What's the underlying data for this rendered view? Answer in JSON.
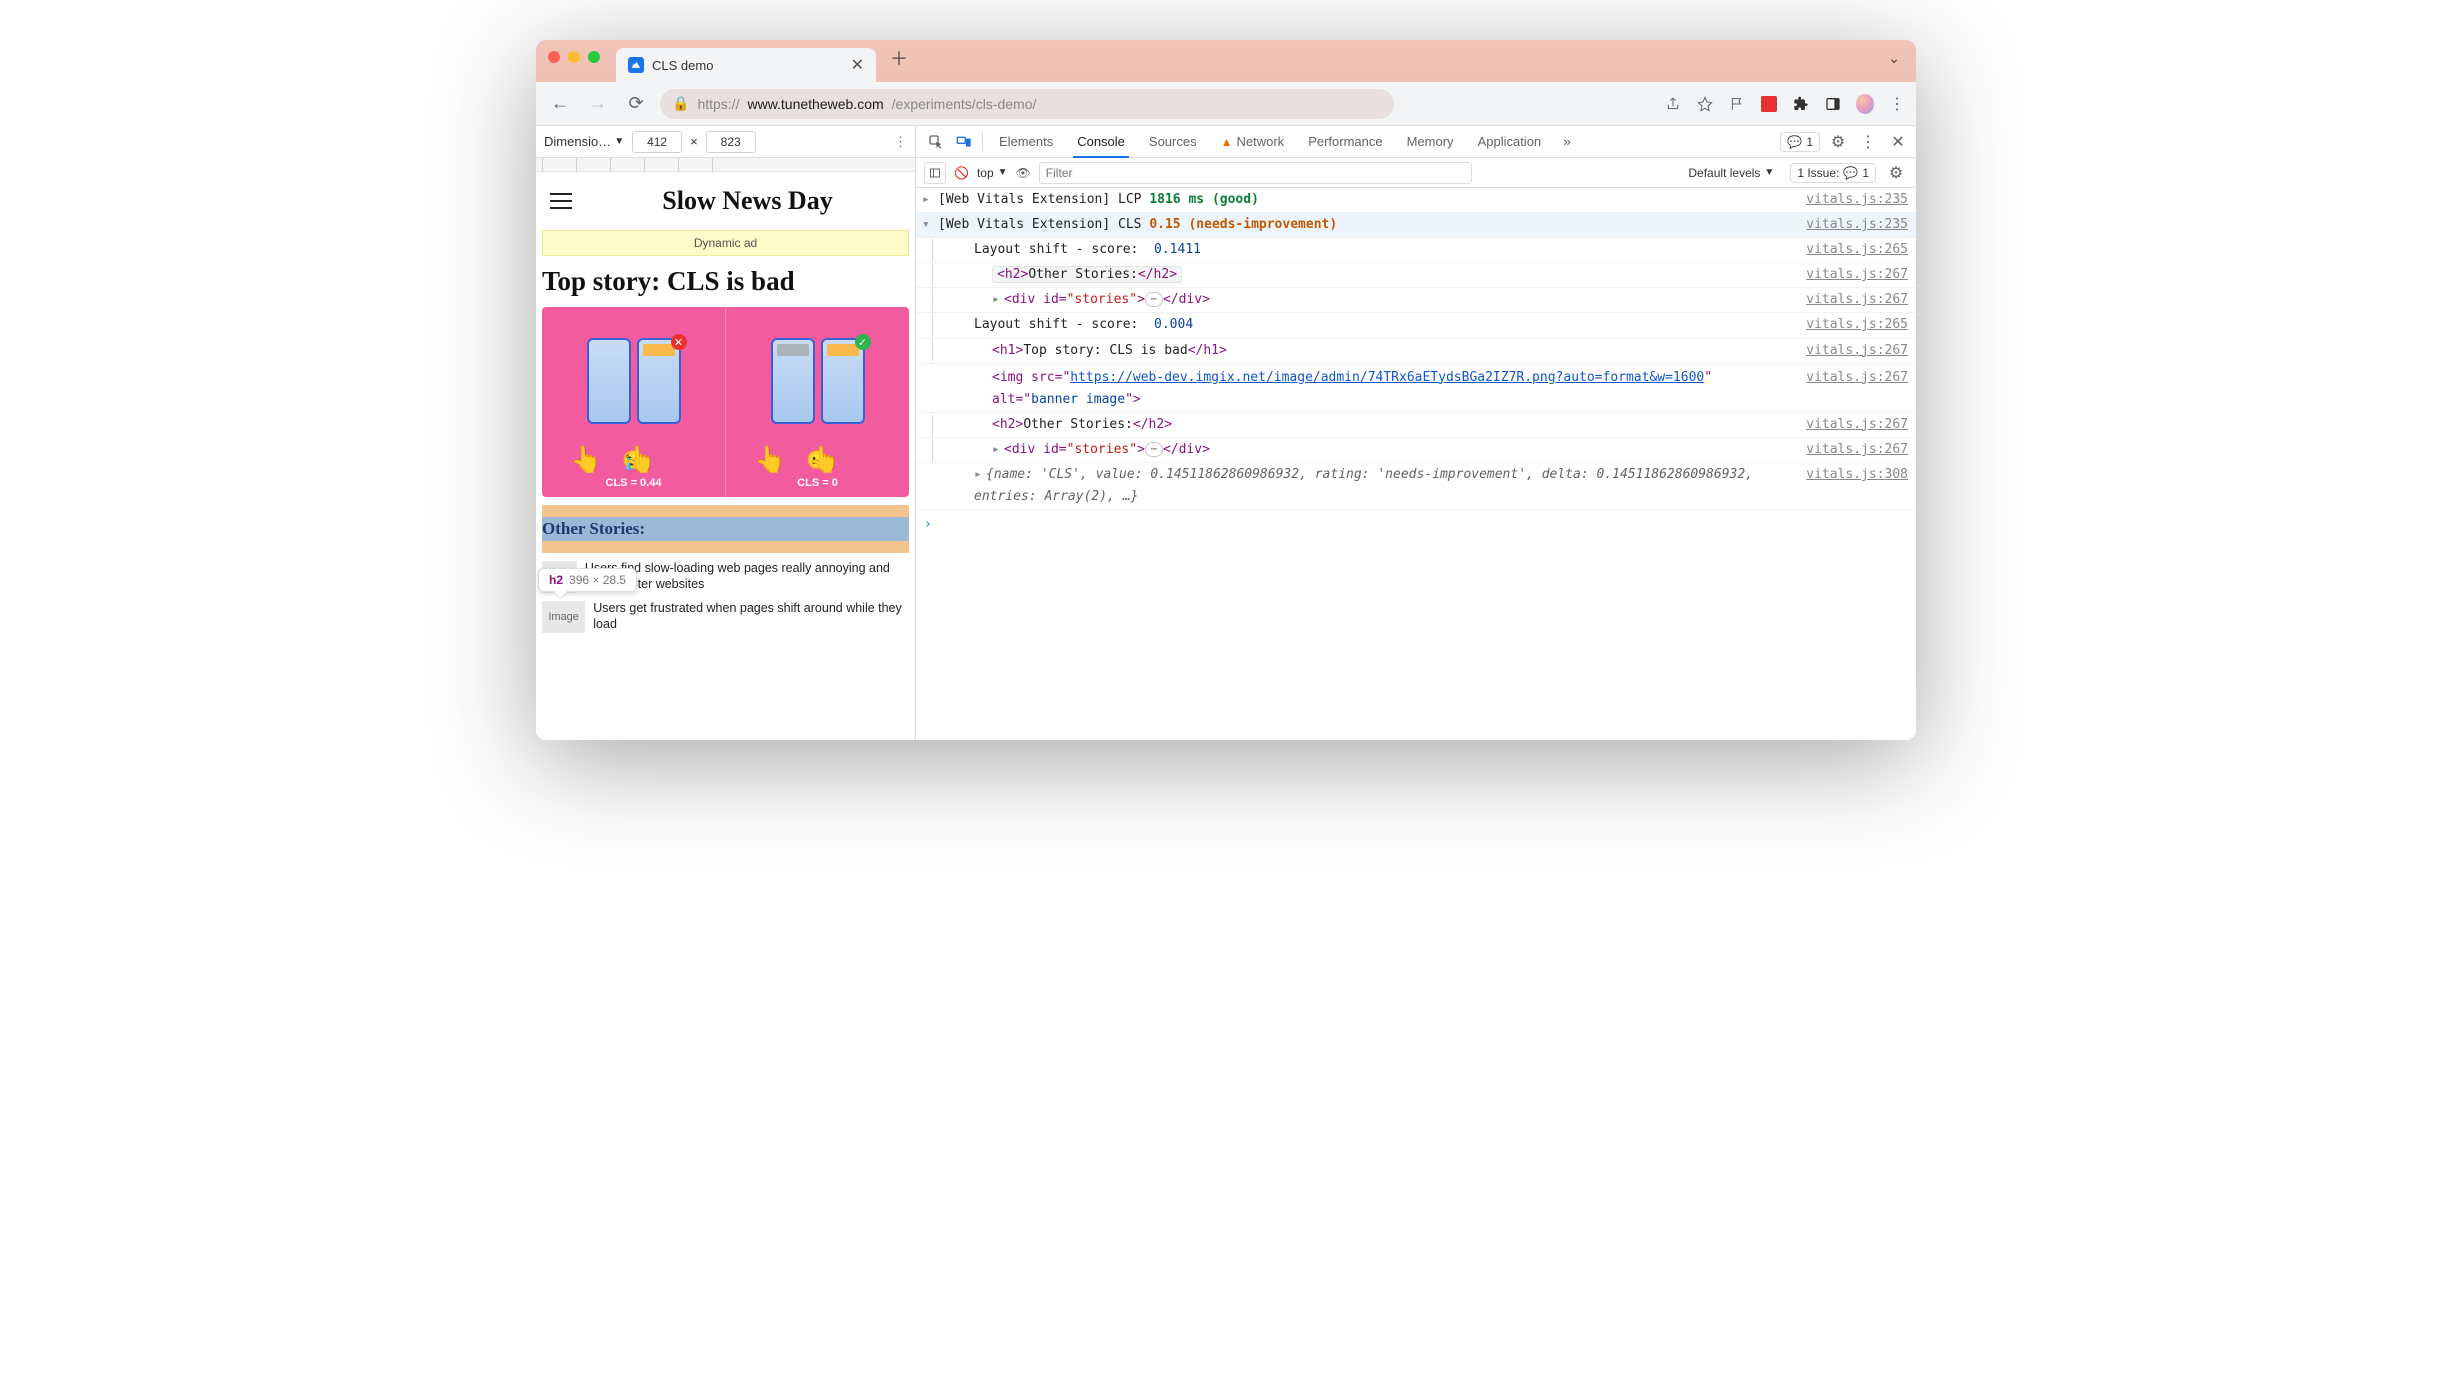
{
  "window": {
    "tab_title": "CLS demo",
    "url_scheme": "https://",
    "url_host": "www.tunetheweb.com",
    "url_path": "/experiments/cls-demo/"
  },
  "device_bar": {
    "label": "Dimensio…",
    "width": "412",
    "times": "×",
    "height": "823"
  },
  "preview": {
    "site_title": "Slow News Day",
    "ad_label": "Dynamic ad",
    "headline": "Top story: CLS is bad",
    "cls_bad_label": "CLS = 0.44",
    "cls_good_label": "CLS = 0",
    "tooltip_tag": "h2",
    "tooltip_size": "396 × 28.5",
    "other_heading": "Other Stories:",
    "thumb_label": "Image",
    "story1": "Users find slow-loading web pages really annoying and prefer faster websites",
    "story2": "Users get frustrated when pages shift around while they load"
  },
  "devtools": {
    "tabs": {
      "elements": "Elements",
      "console": "Console",
      "sources": "Sources",
      "network": "Network",
      "performance": "Performance",
      "memory": "Memory",
      "application": "Application"
    },
    "issue_count": "1",
    "toolbar2": {
      "scope": "top",
      "filter_placeholder": "Filter",
      "levels": "Default levels",
      "issue_label": "1 Issue:",
      "issue_n": "1"
    },
    "console": {
      "r1": {
        "prefix": "[Web Vitals Extension] LCP ",
        "val": "1816 ms",
        "suffix": " (good)",
        "src": "vitals.js:235"
      },
      "r2": {
        "prefix": "[Web Vitals Extension] CLS ",
        "val": "0.15",
        "suffix": " (needs-improvement)",
        "src": "vitals.js:235"
      },
      "r3": {
        "label": "Layout shift - score:  ",
        "val": "0.1411",
        "src": "vitals.js:265"
      },
      "r4": {
        "open": "<h2>",
        "text": "Other Stories:",
        "close": "</h2>",
        "src": "vitals.js:267"
      },
      "r5": {
        "open": "<div id=",
        "attr": "\"stories\"",
        "mid": ">",
        "close": "</div>",
        "src": "vitals.js:267"
      },
      "r6": {
        "label": "Layout shift - score:  ",
        "val": "0.004",
        "src": "vitals.js:265"
      },
      "r7": {
        "open": "<h1>",
        "text": "Top story: CLS is bad",
        "close": "</h1>",
        "src": "vitals.js:267"
      },
      "r8": {
        "open": "<img src=\"",
        "url": "https://web-dev.imgix.net/image/admin/74TRx6aETydsBGa2IZ7R.png?auto=format&w=1600",
        "mid": "\" alt=\"",
        "alt": "banner image",
        "close": "\">",
        "src": "vitals.js:267"
      },
      "r9": {
        "open": "<h2>",
        "text": "Other Stories:",
        "close": "</h2>",
        "src": "vitals.js:267"
      },
      "r10": {
        "open": "<div id=",
        "attr": "\"stories\"",
        "mid": ">",
        "close": "</div>",
        "src": "vitals.js:267"
      },
      "r11": {
        "text": "{name: 'CLS', value: 0.14511862860986932, rating: 'needs-improvement', delta: 0.14511862860986932, entries: Array(2), …}",
        "src": "vitals.js:308"
      }
    }
  }
}
